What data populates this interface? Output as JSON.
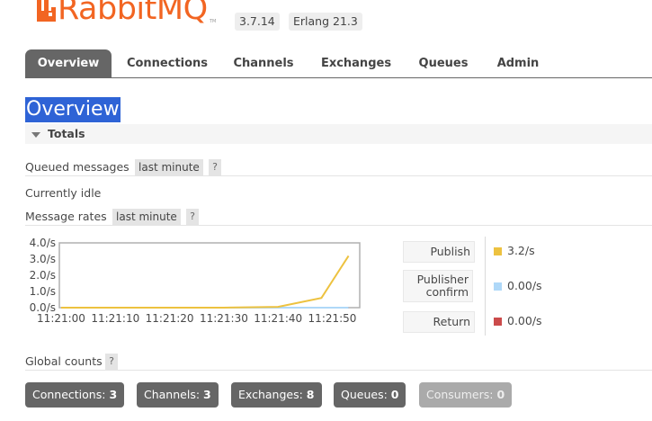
{
  "header": {
    "logo_text": "RabbitMQ",
    "logo_tm": "TM",
    "version": "3.7.14",
    "erlang": "Erlang 21.3"
  },
  "nav": {
    "tabs": [
      {
        "label": "Overview",
        "active": true
      },
      {
        "label": "Connections",
        "active": false
      },
      {
        "label": "Channels",
        "active": false
      },
      {
        "label": "Exchanges",
        "active": false
      },
      {
        "label": "Queues",
        "active": false
      },
      {
        "label": "Admin",
        "active": false
      }
    ]
  },
  "page": {
    "title": "Overview",
    "totals_label": "Totals",
    "queued_messages": {
      "label": "Queued messages",
      "period": "last minute",
      "help": "?"
    },
    "idle_text": "Currently idle",
    "message_rates": {
      "label": "Message rates",
      "period": "last minute",
      "help": "?"
    }
  },
  "chart_data": {
    "type": "line",
    "x": [
      "11:21:00",
      "11:21:10",
      "11:21:20",
      "11:21:30",
      "11:21:40",
      "11:21:50"
    ],
    "y_ticks": [
      "4.0/s",
      "3.0/s",
      "2.0/s",
      "1.0/s",
      "0.0/s"
    ],
    "ylim": [
      0,
      4.0
    ],
    "series": [
      {
        "name": "Publish",
        "color": "#edc240",
        "values": [
          0,
          0,
          0,
          0,
          0.05,
          0.6,
          3.2
        ]
      },
      {
        "name": "Publisher confirm",
        "color": "#afd8f8",
        "values": [
          0,
          0,
          0,
          0,
          0,
          0,
          0
        ]
      },
      {
        "name": "Return",
        "color": "#cb4b4b",
        "values": [
          0,
          0,
          0,
          0,
          0,
          0,
          0
        ]
      }
    ],
    "x_points": [
      "11:21:00",
      "11:21:10",
      "11:21:20",
      "11:21:30",
      "11:21:40",
      "11:21:48",
      "11:21:53"
    ]
  },
  "legend": [
    {
      "label": "Publish",
      "value": "3.2/s",
      "color": "#edc240"
    },
    {
      "label_line1": "Publisher",
      "label_line2": "confirm",
      "value": "0.00/s",
      "color": "#afd8f8"
    },
    {
      "label": "Return",
      "value": "0.00/s",
      "color": "#cb4b4b"
    }
  ],
  "global_counts": {
    "label": "Global counts",
    "help": "?",
    "items": [
      {
        "label": "Connections:",
        "value": "3"
      },
      {
        "label": "Channels:",
        "value": "3"
      },
      {
        "label": "Exchanges:",
        "value": "8"
      },
      {
        "label": "Queues:",
        "value": "0"
      },
      {
        "label": "Consumers:",
        "value": "0"
      }
    ]
  }
}
